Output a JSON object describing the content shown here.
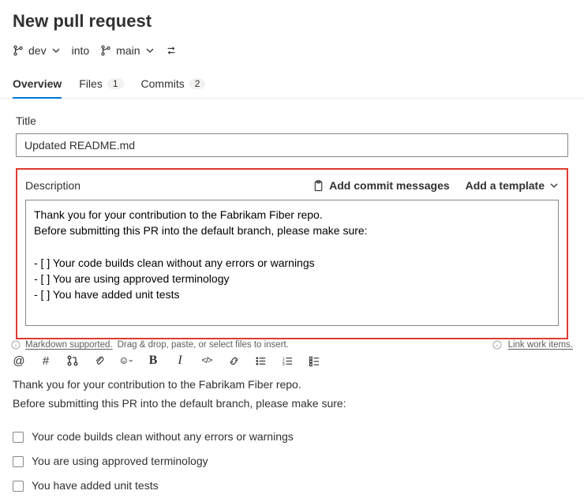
{
  "page_title": "New pull request",
  "branch": {
    "source": "dev",
    "into_label": "into",
    "target": "main"
  },
  "tabs": {
    "overview": "Overview",
    "files": "Files",
    "files_count": "1",
    "commits": "Commits",
    "commits_count": "2"
  },
  "title_field": {
    "label": "Title",
    "value": "Updated README.md"
  },
  "description": {
    "label": "Description",
    "add_commit": "Add commit messages",
    "add_template": "Add a template",
    "value": "Thank you for your contribution to the Fabrikam Fiber repo.\nBefore submitting this PR into the default branch, please make sure:\n\n- [ ] Your code builds clean without any errors or warnings\n- [ ] You are using approved terminology\n- [ ] You have added unit tests"
  },
  "helper": {
    "markdown": "Markdown supported.",
    "drag_hint": "Drag & drop, paste, or select files to insert.",
    "link_work": "Link work items."
  },
  "preview": {
    "line1": "Thank you for your contribution to the Fabrikam Fiber repo.",
    "line2": "Before submitting this PR into the default branch, please make sure:",
    "checks": [
      "Your code builds clean without any errors or warnings",
      "You are using approved terminology",
      "You have added unit tests"
    ]
  }
}
